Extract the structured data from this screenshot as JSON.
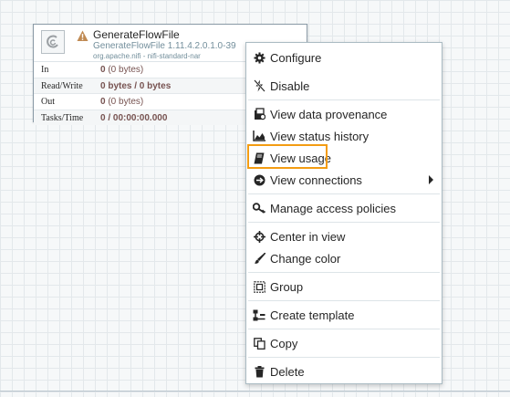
{
  "processor": {
    "name": "GenerateFlowFile",
    "type": "GenerateFlowFile 1.11.4.2.0.1.0-39",
    "bundle": "org.apache.nifi - nifi-standard-nar",
    "status_icon": "warning-icon",
    "stats": [
      {
        "label": "In",
        "value_bold": "0",
        "value_rest": " (0 bytes)"
      },
      {
        "label": "Read/Write",
        "value_bold": "0 bytes / 0 bytes",
        "value_rest": ""
      },
      {
        "label": "Out",
        "value_bold": "0",
        "value_rest": " (0 bytes)"
      },
      {
        "label": "Tasks/Time",
        "value_bold": "0 / 00:00:00.000",
        "value_rest": ""
      }
    ]
  },
  "context_menu": {
    "items": [
      {
        "label": "Configure",
        "icon": "gear-icon"
      },
      {
        "label": "Disable",
        "icon": "disable-icon"
      },
      {
        "label": "View data provenance",
        "icon": "provenance-icon"
      },
      {
        "label": "View status history",
        "icon": "area-chart-icon"
      },
      {
        "label": "View usage",
        "icon": "book-icon"
      },
      {
        "label": "View connections",
        "icon": "connections-icon"
      },
      {
        "label": "Manage access policies",
        "icon": "key-icon"
      },
      {
        "label": "Center in view",
        "icon": "crosshairs-icon"
      },
      {
        "label": "Change color",
        "icon": "paintbrush-icon"
      },
      {
        "label": "Group",
        "icon": "group-icon"
      },
      {
        "label": "Create template",
        "icon": "template-icon"
      },
      {
        "label": "Copy",
        "icon": "copy-icon"
      },
      {
        "label": "Delete",
        "icon": "trash-icon"
      }
    ]
  },
  "colors": {
    "highlight": "#f39c12",
    "stat_value": "#775351",
    "warning": "#c08a53"
  }
}
